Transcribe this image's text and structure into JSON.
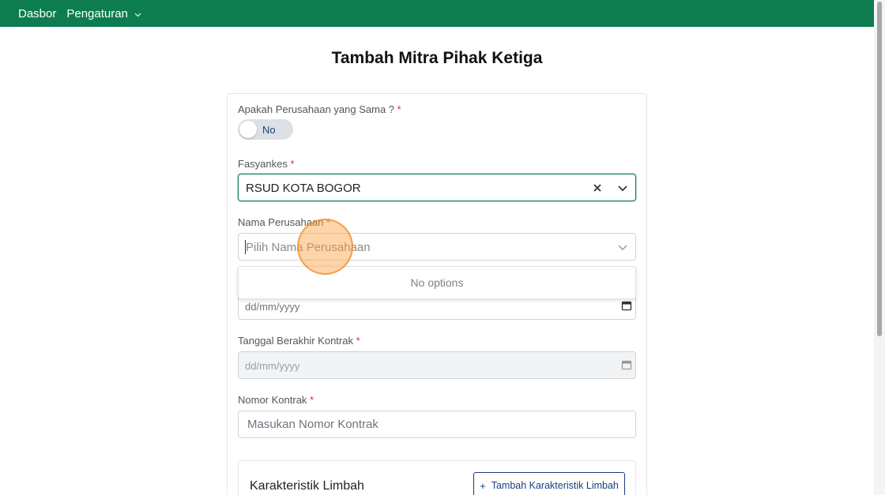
{
  "nav": {
    "dashboard_label": "Dasbor",
    "settings_label": "Pengaturan"
  },
  "page": {
    "title": "Tambah Mitra Pihak Ketiga"
  },
  "form": {
    "same_company": {
      "label": "Apakah Perusahaan yang Sama ?",
      "required_mark": "*",
      "toggle_text": "No"
    },
    "fasyankes": {
      "label": "Fasyankes",
      "required_mark": "*",
      "value": "RSUD KOTA BOGOR"
    },
    "company_name": {
      "label": "Nama Perusahaan",
      "required_mark": "*",
      "placeholder": "Pilih Nama Perusahaan",
      "dropdown_message": "No options"
    },
    "contract_start": {
      "placeholder": "dd/mm/yyyy"
    },
    "contract_end": {
      "label": "Tanggal Berakhir Kontrak",
      "required_mark": "*",
      "placeholder": "dd/mm/yyyy"
    },
    "contract_number": {
      "label": "Nomor Kontrak",
      "required_mark": "*",
      "placeholder": "Masukan Nomor Kontrak"
    },
    "waste_characteristics": {
      "title": "Karakteristik Limbah",
      "add_button_plus": "+",
      "add_button_label": "Tambah Karakteristik Limbah"
    }
  },
  "icons": {
    "nav_dropdown": "chevron-down-icon",
    "clear": "close-icon",
    "select_dropdown": "chevron-down-icon",
    "calendar": "calendar-icon"
  },
  "colors": {
    "topbar": "#0d7d4f",
    "accent": "#1b3f7a",
    "required": "#e03131"
  }
}
